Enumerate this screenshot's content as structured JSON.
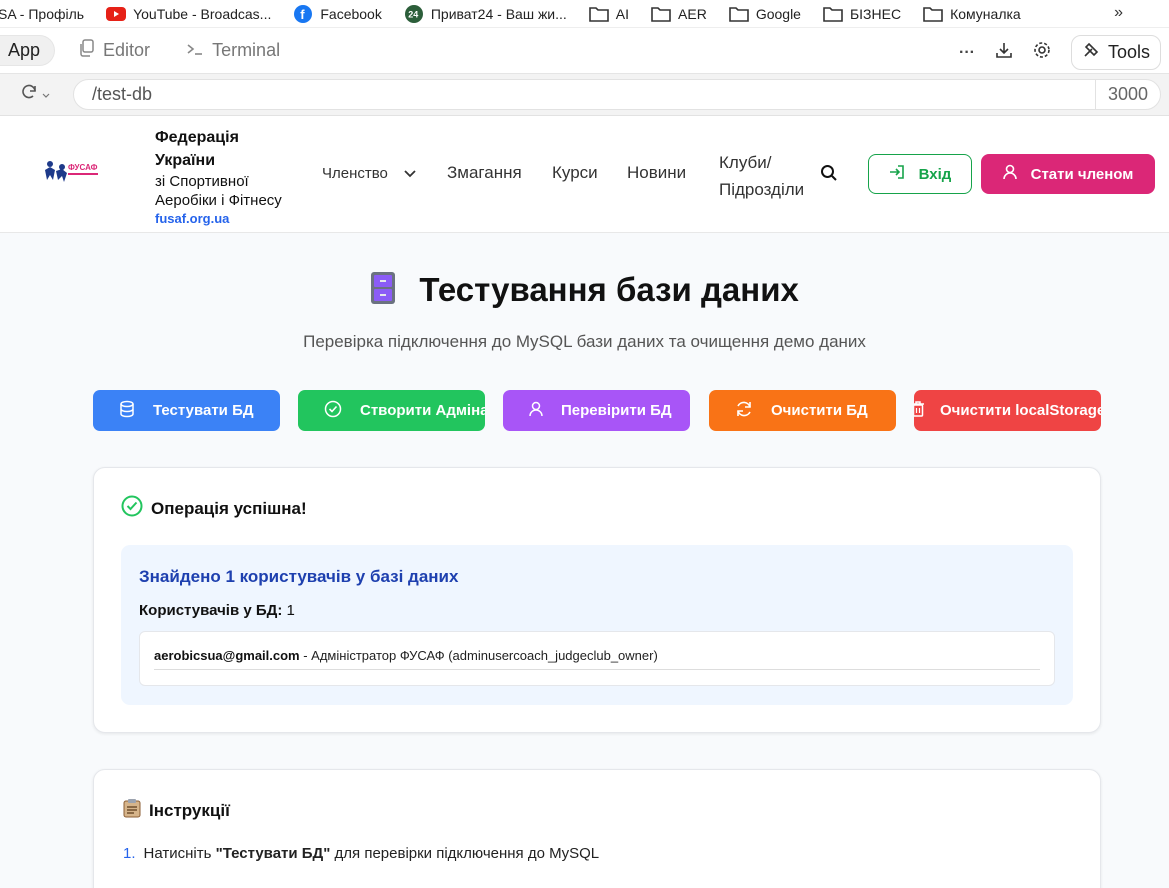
{
  "bookmarks": [
    {
      "label": "SA - Профіль",
      "icon": "none"
    },
    {
      "label": "YouTube - Broadcas...",
      "icon": "youtube-icon"
    },
    {
      "label": "Facebook",
      "icon": "facebook-icon"
    },
    {
      "label": "Приват24 - Ваш жи...",
      "icon": "privat24-icon"
    },
    {
      "label": "AI",
      "icon": "folder-icon"
    },
    {
      "label": "AER",
      "icon": "folder-icon"
    },
    {
      "label": "Google",
      "icon": "folder-icon"
    },
    {
      "label": "БІЗНЕС",
      "icon": "folder-icon"
    },
    {
      "label": "Комуналка",
      "icon": "folder-icon"
    }
  ],
  "bookmarks_more": "»",
  "ide": {
    "tabs": [
      {
        "label": "App",
        "icon": "none"
      },
      {
        "label": "Editor",
        "icon": "copy-icon"
      },
      {
        "label": "Terminal",
        "icon": "terminal-icon"
      }
    ],
    "more": "···",
    "tools_label": "Tools"
  },
  "url": {
    "path": "/test-db",
    "port": "3000"
  },
  "header": {
    "logo_text": "ФУСАФ",
    "brand_line1": "Федерація",
    "brand_line2": "України",
    "brand_line3": "зі Спортивної",
    "brand_line4": "Аеробіки і Фітнесу",
    "brand_url": "fusaf.org.ua",
    "nav": {
      "membership": "Членство",
      "competitions": "Змагання",
      "courses": "Курси",
      "news": "Новини",
      "clubs_line1": "Клуби/",
      "clubs_line2": "Підрозділи"
    },
    "login_label": "Вхід",
    "join_label": "Стати членом"
  },
  "page": {
    "title": "Тестування бази даних",
    "subtitle": "Перевірка підключення до MySQL бази даних та очищення демо даних",
    "actions": [
      {
        "label": "Тестувати БД",
        "color": "#3b82f6",
        "icon": "database-icon"
      },
      {
        "label": "Створити Адміна",
        "color": "#22c55e",
        "icon": "check-circle-icon"
      },
      {
        "label": "Перевірити БД",
        "color": "#a855f7",
        "icon": "user-icon"
      },
      {
        "label": "Очистити БД",
        "color": "#f97316",
        "icon": "refresh-icon"
      },
      {
        "label": "Очистити localStorage",
        "color": "#ef4444",
        "icon": "trash-icon"
      }
    ]
  },
  "result": {
    "status": "Операція успішна!",
    "found_title": "Знайдено 1 користувачів у базі даних",
    "count_label": "Користувачів у БД:",
    "count_value": "1",
    "users": [
      {
        "email": "aerobicsua@gmail.com",
        "details": " - Адміністратор ФУСАФ (adminusercoach_judgeclub_owner)"
      }
    ]
  },
  "instructions": {
    "title": "Інструкції",
    "steps": [
      {
        "num": "1.",
        "pre": "Натисніть ",
        "bold": "\"Тестувати БД\"",
        "post": " для перевірки підключення до MySQL"
      }
    ]
  },
  "colors": {
    "accent_green": "#16a34a",
    "accent_pink": "#db2777",
    "info_blue": "#1e40af"
  }
}
